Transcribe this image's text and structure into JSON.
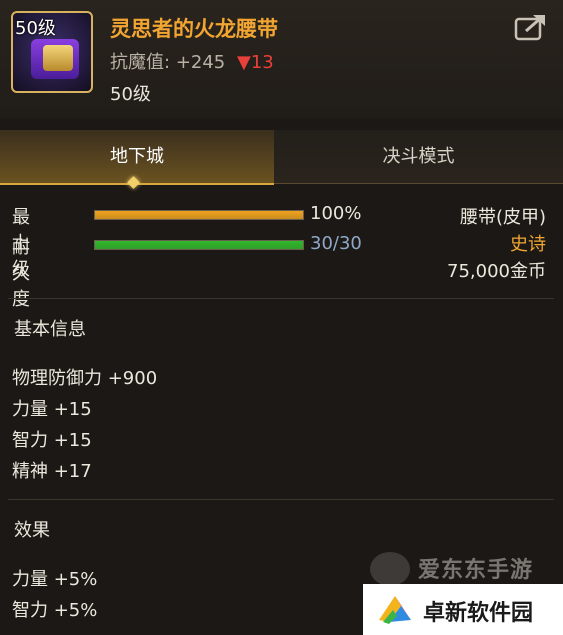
{
  "item": {
    "level_badge": "50级",
    "name": "灵思者的火龙腰带",
    "stat_label": "抗魔值:",
    "stat_value": "+245",
    "stat_delta": "▼13",
    "required_level": "50级"
  },
  "tabs": [
    {
      "label": "地下城",
      "active": true
    },
    {
      "label": "决斗模式",
      "active": false
    }
  ],
  "bars": [
    {
      "label": "最上级",
      "value_text": "100%",
      "fraction": 1.0,
      "color": "#f0a21e"
    },
    {
      "label": "耐久度",
      "value_text": "30/30",
      "fraction": 1.0,
      "color": "#2fb82a"
    }
  ],
  "side_info": {
    "type": "腰带(皮甲)",
    "rarity": "史诗",
    "rarity_color": "#f2a631",
    "price": "75,000金币"
  },
  "basic_info": {
    "title": "基本信息",
    "attributes": [
      "物理防御力 +900",
      "力量 +15",
      "智力 +15",
      "精神 +17"
    ]
  },
  "effect": {
    "title": "效果",
    "attributes": [
      "力量 +5%",
      "智力 +5%"
    ]
  },
  "watermarks": {
    "top": "爱东东手游",
    "bottom": "卓新软件园"
  }
}
